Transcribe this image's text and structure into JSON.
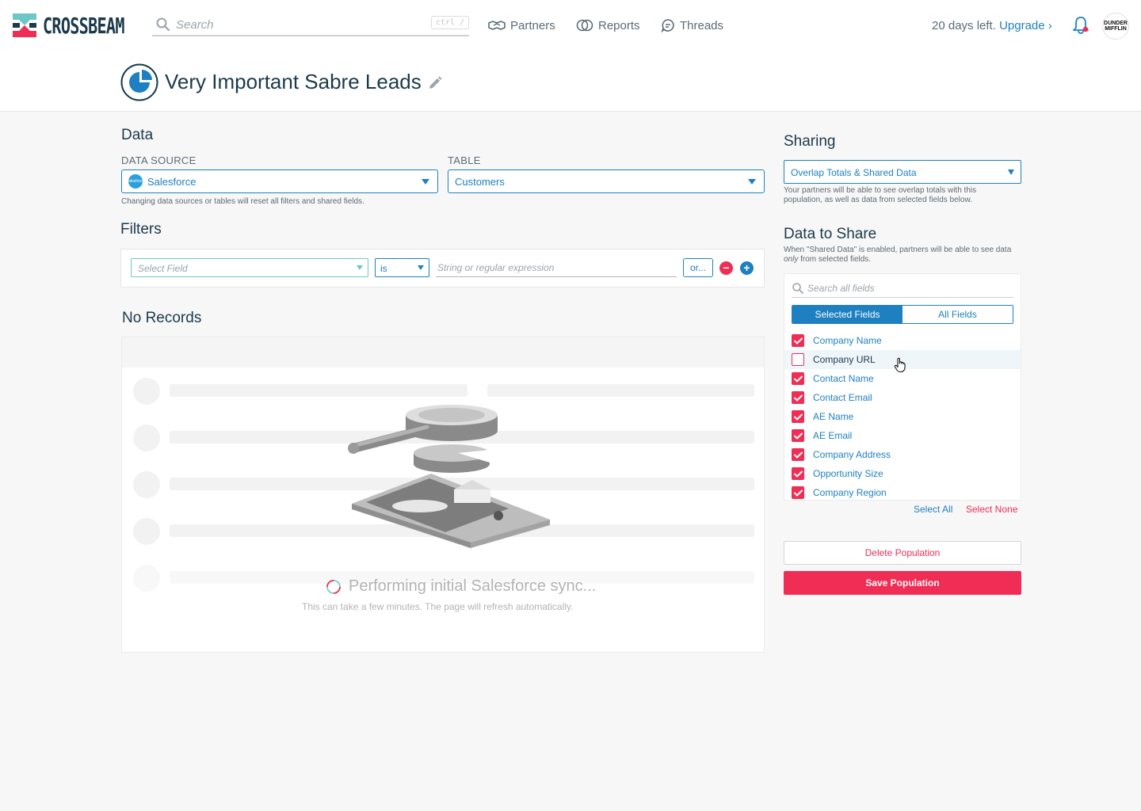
{
  "app": {
    "logo_text": "CROSSBEAM",
    "search_placeholder": "Search",
    "search_shortcut": "ctrl /",
    "nav": [
      {
        "label": "Partners",
        "icon": "handshake-icon"
      },
      {
        "label": "Reports",
        "icon": "overlap-circles-icon"
      },
      {
        "label": "Threads",
        "icon": "chat-bubble-icon"
      }
    ],
    "trial_text": "20 days left.",
    "upgrade_label": "Upgrade ›",
    "avatar_text": "DUNDER MIFFLIN"
  },
  "header": {
    "title": "Very Important Sabre Leads"
  },
  "data_section": {
    "heading": "Data",
    "source_label": "DATA SOURCE",
    "source_value": "Salesforce",
    "source_icon_text": "salesforce",
    "table_label": "TABLE",
    "table_value": "Customers",
    "hint": "Changing data sources or tables will reset all filters and shared fields."
  },
  "filters": {
    "heading": "Filters",
    "field_placeholder": "Select Field",
    "operator": "is",
    "value_placeholder": "String or regular expression",
    "or_label": "or...",
    "remove_symbol": "−",
    "add_symbol": "+"
  },
  "records": {
    "heading": "No Records",
    "sync_title": "Performing initial Salesforce sync...",
    "sync_subtitle": "This can take a few minutes. The page will refresh automatically."
  },
  "sharing": {
    "heading": "Sharing",
    "level": "Overlap Totals & Shared Data",
    "hint": "Your partners will be able to see overlap totals with this population, as well as data from selected fields below."
  },
  "data_to_share": {
    "heading": "Data to Share",
    "hint_prefix": "When \"Shared Data\" is enabled, partners will be able to see data ",
    "hint_emphasis": "only",
    "hint_suffix": " from selected fields.",
    "search_placeholder": "Search all fields",
    "tab_selected": "Selected Fields",
    "tab_all": "All Fields",
    "fields": [
      {
        "label": "Company Name",
        "checked": true
      },
      {
        "label": "Company URL",
        "checked": false
      },
      {
        "label": "Contact Name",
        "checked": true
      },
      {
        "label": "Contact Email",
        "checked": true
      },
      {
        "label": "AE Name",
        "checked": true
      },
      {
        "label": "AE Email",
        "checked": true
      },
      {
        "label": "Company Address",
        "checked": true
      },
      {
        "label": "Opportunity Size",
        "checked": true
      },
      {
        "label": "Company Region",
        "checked": true
      }
    ],
    "select_all": "Select All",
    "select_none": "Select None"
  },
  "actions": {
    "delete_label": "Delete Population",
    "save_label": "Save Population"
  },
  "colors": {
    "primary": "#1f80c1",
    "accent": "#ef2d55",
    "navy": "#1b3a4b",
    "teal": "#6fc6c7"
  }
}
